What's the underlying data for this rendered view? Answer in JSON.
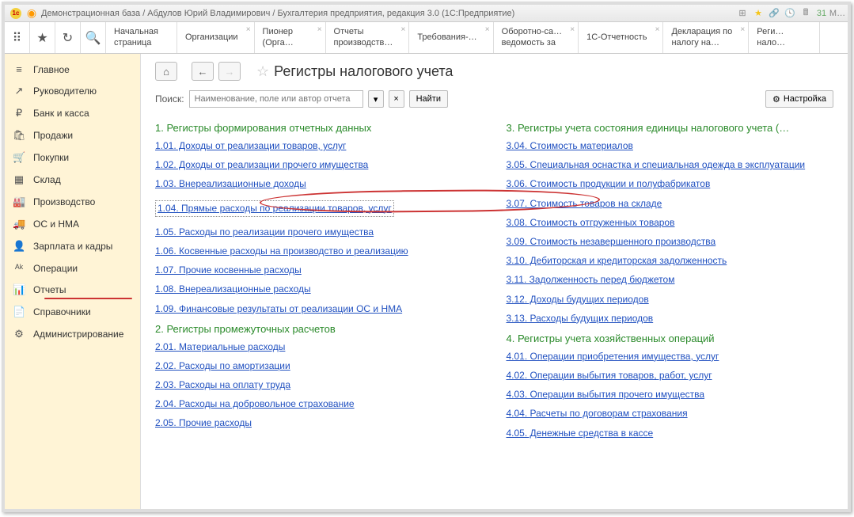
{
  "titlebar": {
    "text": "Демонстрационная база / Абдулов Юрий Владимирович / Бухгалтерия предприятия, редакция 3.0   (1С:Предприятие)"
  },
  "tabs": [
    {
      "line1": "Начальная",
      "line2": "страница",
      "x": false
    },
    {
      "line1": "Организации",
      "line2": "",
      "x": true
    },
    {
      "line1": "Пионер",
      "line2": "(Орга…",
      "x": true
    },
    {
      "line1": "Отчеты",
      "line2": "производств…",
      "x": true
    },
    {
      "line1": "Требования-…",
      "line2": "",
      "x": true
    },
    {
      "line1": "Оборотно-са…",
      "line2": "ведомость за",
      "x": true
    },
    {
      "line1": "1С-Отчетность",
      "line2": "",
      "x": true
    },
    {
      "line1": "Декларация по",
      "line2": "налогу на…",
      "x": true
    },
    {
      "line1": "Реги…",
      "line2": "нало…",
      "x": false
    }
  ],
  "sidebar": [
    {
      "icon": "≡",
      "label": "Главное"
    },
    {
      "icon": "↗",
      "label": "Руководителю"
    },
    {
      "icon": "₽",
      "label": "Банк и касса"
    },
    {
      "icon": "🛍",
      "label": "Продажи"
    },
    {
      "icon": "🛒",
      "label": "Покупки"
    },
    {
      "icon": "▦",
      "label": "Склад"
    },
    {
      "icon": "🏭",
      "label": "Производство"
    },
    {
      "icon": "🚚",
      "label": "ОС и НМА"
    },
    {
      "icon": "👤",
      "label": "Зарплата и кадры"
    },
    {
      "icon": "ᴬᵏ",
      "label": "Операции"
    },
    {
      "icon": "📊",
      "label": "Отчеты"
    },
    {
      "icon": "📄",
      "label": "Справочники"
    },
    {
      "icon": "⚙",
      "label": "Администрирование"
    }
  ],
  "page": {
    "title": "Регистры налогового учета",
    "search_label": "Поиск:",
    "search_placeholder": "Наименование, поле или автор отчета",
    "find_label": "Найти",
    "settings_label": "Настройка"
  },
  "sections": {
    "s1": {
      "title": "1. Регистры формирования отчетных данных",
      "links": [
        "1.01. Доходы от реализации товаров, услуг",
        "1.02. Доходы от реализации прочего имущества",
        "1.03. Внереализационные доходы",
        "1.04. Прямые расходы по реализации товаров, услуг",
        "1.05. Расходы по реализации прочего имущества",
        "1.06. Косвенные расходы на производство и реализацию",
        "1.07. Прочие косвенные расходы",
        "1.08. Внереализационные расходы",
        "1.09. Финансовые результаты от реализации ОС и НМА"
      ]
    },
    "s2": {
      "title": "2. Регистры промежуточных расчетов",
      "links": [
        "2.01. Материальные расходы",
        "2.02. Расходы по амортизации",
        "2.03. Расходы на оплату труда",
        "2.04. Расходы на добровольное страхование",
        "2.05. Прочие расходы"
      ]
    },
    "s3": {
      "title": "3. Регистры учета состояния единицы налогового учета (…",
      "links": [
        "3.04. Стоимость материалов",
        "3.05. Специальная оснастка и специальная одежда в эксплуатации",
        "3.06. Стоимость продукции и полуфабрикатов",
        "3.07. Стоимость товаров на складе",
        "3.08. Стоимость отгруженных товаров",
        "3.09. Стоимость незавершенного производства",
        "3.10. Дебиторская и кредиторская задолженность",
        "3.11. Задолженность перед бюджетом",
        "3.12. Доходы будущих периодов",
        "3.13. Расходы будущих периодов"
      ]
    },
    "s4": {
      "title": "4. Регистры учета хозяйственных операций",
      "links": [
        "4.01. Операции приобретения имущества, услуг",
        "4.02. Операции выбытия товаров, работ, услуг",
        "4.03. Операции выбытия прочего имущества",
        "4.04. Расчеты по договорам страхования",
        "4.05. Денежные средства в кассе"
      ]
    }
  }
}
